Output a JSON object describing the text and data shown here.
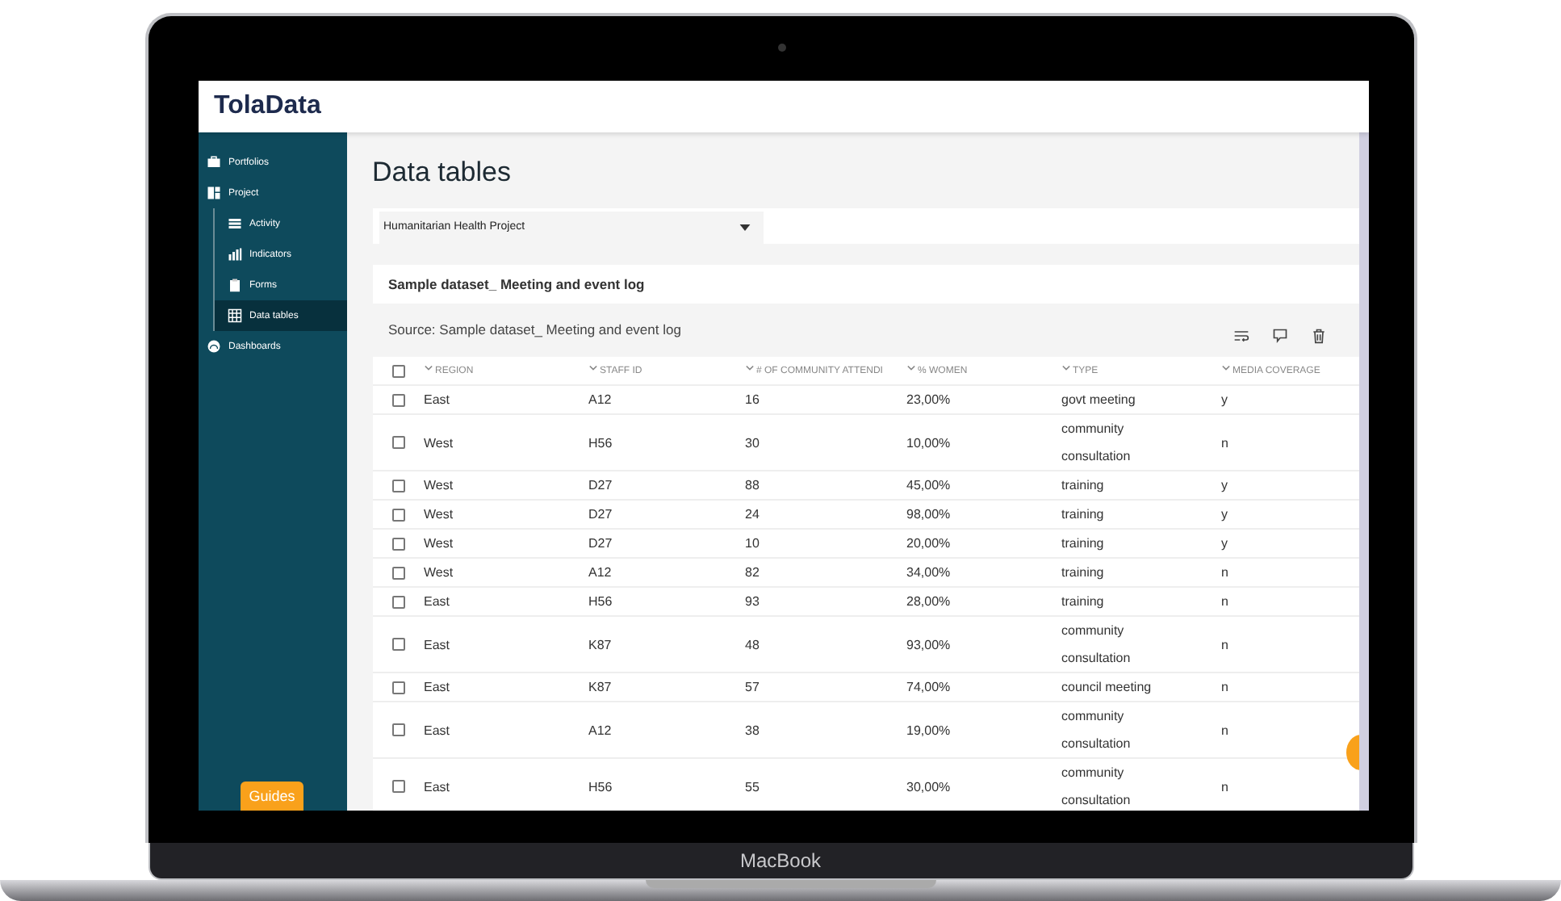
{
  "device": {
    "label": "MacBook"
  },
  "app": {
    "logo": "TolaData"
  },
  "sidebar": {
    "items": [
      {
        "label": "Portfolios",
        "selected": false
      },
      {
        "label": "Project",
        "selected": false,
        "children": [
          {
            "label": "Activity",
            "selected": false
          },
          {
            "label": "Indicators",
            "selected": false
          },
          {
            "label": "Forms",
            "selected": false
          },
          {
            "label": "Data tables",
            "selected": true
          }
        ]
      },
      {
        "label": "Dashboards",
        "selected": false
      }
    ],
    "guides_button": "Guides"
  },
  "page": {
    "title": "Data tables",
    "project_select": {
      "value": "Humanitarian Health Project"
    },
    "dataset_title": "Sample dataset_ Meeting and event log",
    "source": "Source: Sample dataset_ Meeting and event log"
  },
  "table": {
    "header_checked": false,
    "columns": [
      "REGION",
      "STAFF ID",
      "# OF COMMUNITY ATTENDI",
      "% WOMEN",
      "TYPE",
      "MEDIA COVERAGE"
    ],
    "rows": [
      {
        "selected": false,
        "cells": [
          "East",
          "A12",
          "16",
          "23,00%",
          "govt meeting",
          "y"
        ]
      },
      {
        "selected": false,
        "cells": [
          "West",
          "H56",
          "30",
          "10,00%",
          "community consultation",
          "n"
        ]
      },
      {
        "selected": false,
        "cells": [
          "West",
          "D27",
          "88",
          "45,00%",
          "training",
          "y"
        ]
      },
      {
        "selected": false,
        "cells": [
          "West",
          "D27",
          "24",
          "98,00%",
          "training",
          "y"
        ]
      },
      {
        "selected": false,
        "cells": [
          "West",
          "D27",
          "10",
          "20,00%",
          "training",
          "y"
        ]
      },
      {
        "selected": false,
        "cells": [
          "West",
          "A12",
          "82",
          "34,00%",
          "training",
          "n"
        ]
      },
      {
        "selected": false,
        "cells": [
          "East",
          "H56",
          "93",
          "28,00%",
          "training",
          "n"
        ]
      },
      {
        "selected": false,
        "cells": [
          "East",
          "K87",
          "48",
          "93,00%",
          "community consultation",
          "n"
        ]
      },
      {
        "selected": false,
        "cells": [
          "East",
          "K87",
          "57",
          "74,00%",
          "council meeting",
          "n"
        ]
      },
      {
        "selected": false,
        "cells": [
          "East",
          "A12",
          "38",
          "19,00%",
          "community consultation",
          "n"
        ]
      },
      {
        "selected": false,
        "cells": [
          "East",
          "H56",
          "55",
          "30,00%",
          "community consultation",
          "n"
        ]
      }
    ]
  }
}
